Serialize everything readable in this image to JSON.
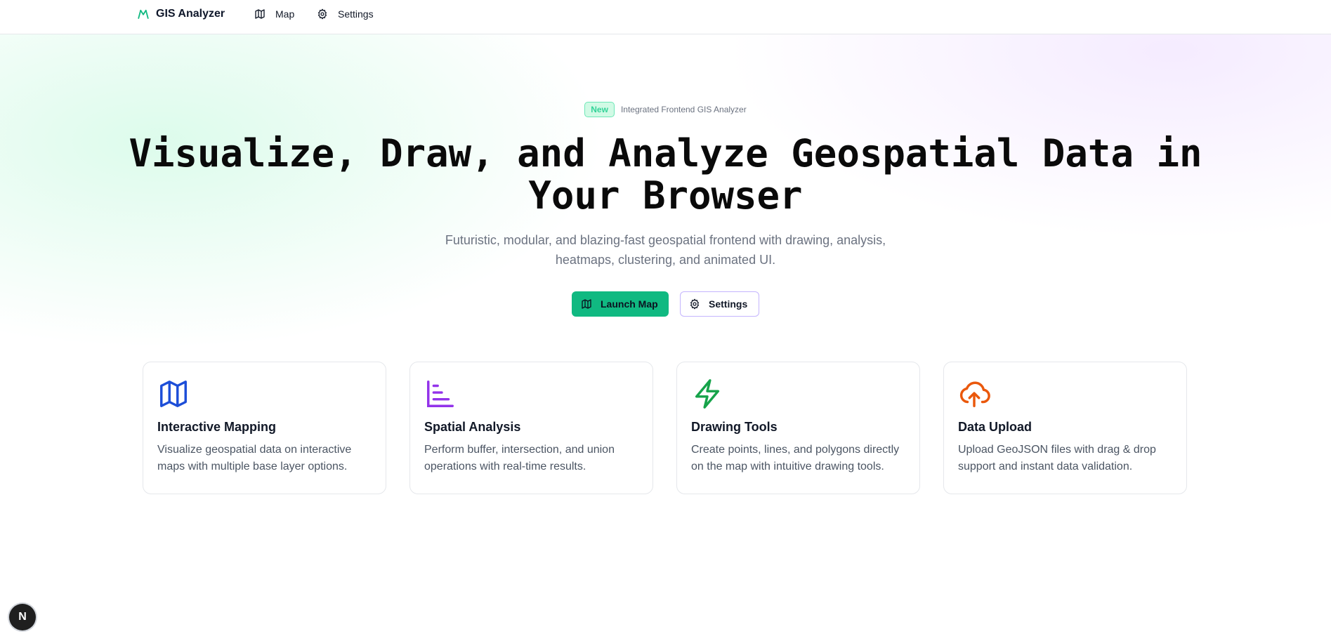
{
  "nav": {
    "brand": "GIS Analyzer",
    "links": [
      {
        "label": "Map",
        "icon": "map-icon"
      },
      {
        "label": "Settings",
        "icon": "gear-icon"
      }
    ]
  },
  "hero": {
    "badge": "New",
    "badge_text": "Integrated Frontend GIS Analyzer",
    "title_line1": "Visualize, Draw, and Analyze Geospatial Data in",
    "title_line2": "Your Browser",
    "subtitle": "Futuristic, modular, and blazing-fast geospatial frontend with drawing, analysis, heatmaps, clustering, and animated UI.",
    "primary_cta": "Launch Map",
    "secondary_cta": "Settings"
  },
  "features": [
    {
      "icon": "map-icon",
      "color": "#1d4ed8",
      "title": "Interactive Mapping",
      "description": "Visualize geospatial data on interactive maps with multiple base layer options."
    },
    {
      "icon": "chart-icon",
      "color": "#9333ea",
      "title": "Spatial Analysis",
      "description": "Perform buffer, intersection, and union operations with real-time results."
    },
    {
      "icon": "lightning-icon",
      "color": "#16a34a",
      "title": "Drawing Tools",
      "description": "Create points, lines, and polygons directly on the map with intuitive drawing tools."
    },
    {
      "icon": "cloud-upload-icon",
      "color": "#ea580c",
      "title": "Data Upload",
      "description": "Upload GeoJSON files with drag & drop support and instant data validation."
    }
  ],
  "dev_badge": "N",
  "colors": {
    "accent": "#10b981",
    "secondary_border": "#c4b5fd"
  }
}
